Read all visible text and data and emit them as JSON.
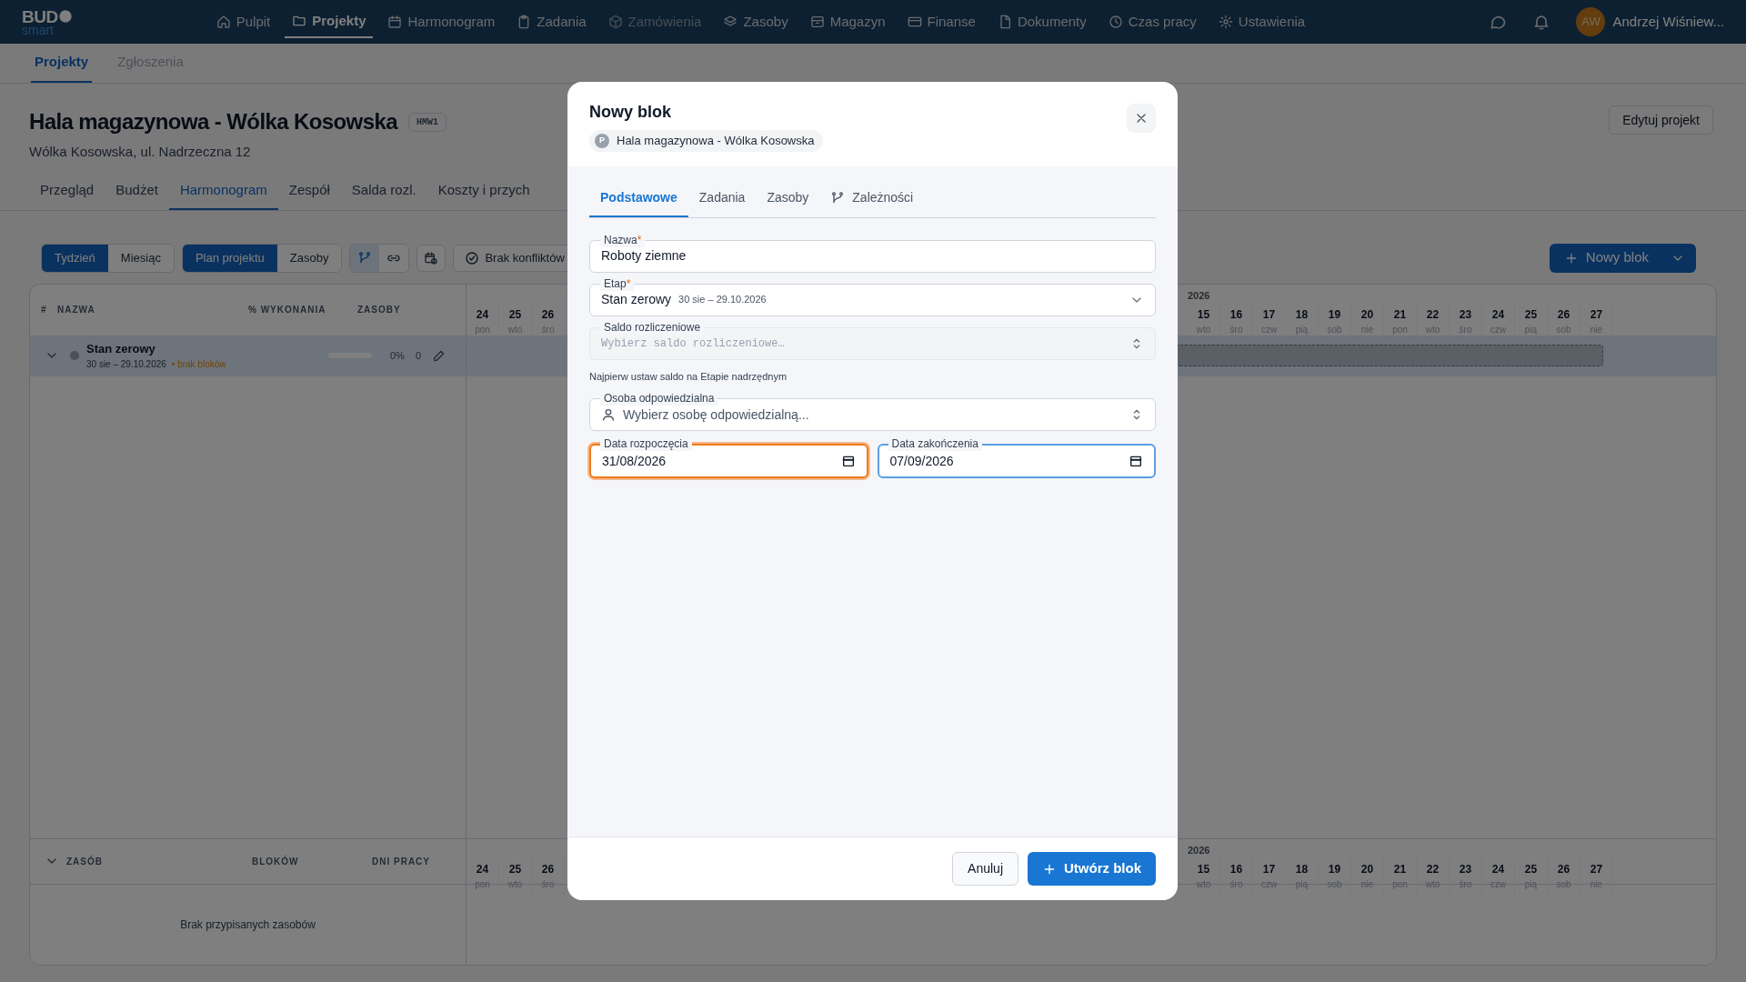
{
  "nav": {
    "logo": "BUD",
    "logo_sub": "smart",
    "items": [
      {
        "label": "Pulpit",
        "selected": false,
        "disabled": false
      },
      {
        "label": "Projekty",
        "selected": true,
        "disabled": false
      },
      {
        "label": "Harmonogram",
        "selected": false,
        "disabled": false
      },
      {
        "label": "Zadania",
        "selected": false,
        "disabled": false
      },
      {
        "label": "Zamówienia",
        "selected": false,
        "disabled": true
      },
      {
        "label": "Zasoby",
        "selected": false,
        "disabled": false
      },
      {
        "label": "Magazyn",
        "selected": false,
        "disabled": false
      },
      {
        "label": "Finanse",
        "selected": false,
        "disabled": false
      },
      {
        "label": "Dokumenty",
        "selected": false,
        "disabled": false
      },
      {
        "label": "Czas pracy",
        "selected": false,
        "disabled": false
      },
      {
        "label": "Ustawienia",
        "selected": false,
        "disabled": false
      }
    ],
    "user": {
      "initials": "AW",
      "name": "Andrzej Wiśniew..."
    }
  },
  "subtabs": [
    {
      "label": "Projekty",
      "selected": true
    },
    {
      "label": "Zgłoszenia",
      "selected": false
    }
  ],
  "project": {
    "title": "Hala magazynowa - Wólka Kosowska",
    "code": "HMW1",
    "address": "Wólka Kosowska, ul. Nadrzeczna 12",
    "edit_button": "Edytuj projekt"
  },
  "project_tabs": [
    {
      "label": "Przegląd",
      "selected": false
    },
    {
      "label": "Budżet",
      "selected": false
    },
    {
      "label": "Harmonogram",
      "selected": true
    },
    {
      "label": "Zespół",
      "selected": false
    },
    {
      "label": "Salda rozl.",
      "selected": false
    },
    {
      "label": "Koszty i przych",
      "selected": false
    }
  ],
  "toolbar": {
    "range": [
      {
        "label": "Tydzień",
        "selected": true
      },
      {
        "label": "Miesiąc",
        "selected": false
      }
    ],
    "mode": [
      {
        "label": "Plan projektu",
        "selected": true
      },
      {
        "label": "Zasoby",
        "selected": false
      }
    ],
    "view_icons": [
      {
        "selected": true
      },
      {
        "selected": false
      }
    ],
    "conflicts": "Brak konfliktów",
    "new_block": "Nowy blok"
  },
  "table": {
    "columns": [
      "#",
      "NAZWA",
      "% WYKONANIA",
      "ZASOBY"
    ],
    "rows": [
      {
        "name": "Stan zerowy",
        "dates": "30 sie – 29.10.2026",
        "warning": "• brak bloków",
        "expanded": true,
        "level": 0,
        "progress": "0%",
        "resources": "0"
      }
    ]
  },
  "timeline": {
    "year": "2026",
    "days_left": [
      {
        "day": "24",
        "weekday": "pon"
      },
      {
        "day": "25",
        "weekday": "wto"
      },
      {
        "day": "26",
        "weekday": "śro"
      }
    ],
    "days_right": [
      {
        "day": "15",
        "weekday": "wto"
      },
      {
        "day": "16",
        "weekday": "śro"
      },
      {
        "day": "17",
        "weekday": "czw"
      },
      {
        "day": "18",
        "weekday": "pią"
      },
      {
        "day": "19",
        "weekday": "sob"
      },
      {
        "day": "20",
        "weekday": "nie"
      },
      {
        "day": "21",
        "weekday": "pon"
      },
      {
        "day": "22",
        "weekday": "wto"
      },
      {
        "day": "23",
        "weekday": "śro"
      },
      {
        "day": "24",
        "weekday": "czw"
      },
      {
        "day": "25",
        "weekday": "pią"
      },
      {
        "day": "26",
        "weekday": "sob"
      },
      {
        "day": "27",
        "weekday": "nie"
      }
    ]
  },
  "resource_timeline": {
    "year": "2026",
    "days_left": [
      {
        "day": "24",
        "weekday": "pon"
      },
      {
        "day": "25",
        "weekday": "wto"
      },
      {
        "day": "26",
        "weekday": "śro"
      }
    ],
    "days_right": [
      {
        "day": "15",
        "weekday": "wto"
      },
      {
        "day": "16",
        "weekday": "śro"
      },
      {
        "day": "17",
        "weekday": "czw"
      },
      {
        "day": "18",
        "weekday": "pią"
      },
      {
        "day": "19",
        "weekday": "sob"
      },
      {
        "day": "20",
        "weekday": "nie"
      },
      {
        "day": "21",
        "weekday": "pon"
      },
      {
        "day": "22",
        "weekday": "wto"
      },
      {
        "day": "23",
        "weekday": "śro"
      },
      {
        "day": "24",
        "weekday": "czw"
      },
      {
        "day": "25",
        "weekday": "pią"
      },
      {
        "day": "26",
        "weekday": "sob"
      },
      {
        "day": "27",
        "weekday": "nie"
      }
    ]
  },
  "resources": {
    "columns": [
      "ZASÓB",
      "BLOKÓW",
      "DNI PRACY"
    ],
    "expanded": true,
    "empty": "Brak przypisanych zasobów"
  },
  "modal": {
    "title": "Nowy blok",
    "project_initial": "P",
    "project": "Hala magazynowa - Wólka Kosowska",
    "tabs": [
      {
        "label": "Podstawowe",
        "selected": true
      },
      {
        "label": "Zadania",
        "selected": false
      },
      {
        "label": "Zasoby",
        "selected": false
      },
      {
        "label": "Zależności",
        "selected": false
      }
    ],
    "name": {
      "label": "Nazwa",
      "required_mark": "*",
      "value": "Roboty ziemne"
    },
    "stage": {
      "label": "Etap",
      "required_mark": "*",
      "value": "Stan zerowy",
      "range": "30 sie – 29.10.2026"
    },
    "balance": {
      "label": "Saldo rozliczeniowe",
      "placeholder": "Wybierz saldo rozliczeniowe…",
      "disabled": true,
      "hint": "Najpierw ustaw saldo na Etapie nadrzędnym"
    },
    "person": {
      "label": "Osoba odpowiedzialna",
      "placeholder": "Wybierz osobę odpowiedzialną..."
    },
    "start": {
      "label": "Data rozpoczęcia",
      "value": "31/08/2026",
      "warning": true
    },
    "end": {
      "label": "Data zakończenia",
      "value": "07/09/2026",
      "focused": true
    },
    "cancel": "Anuluj",
    "submit": "Utwórz blok"
  }
}
